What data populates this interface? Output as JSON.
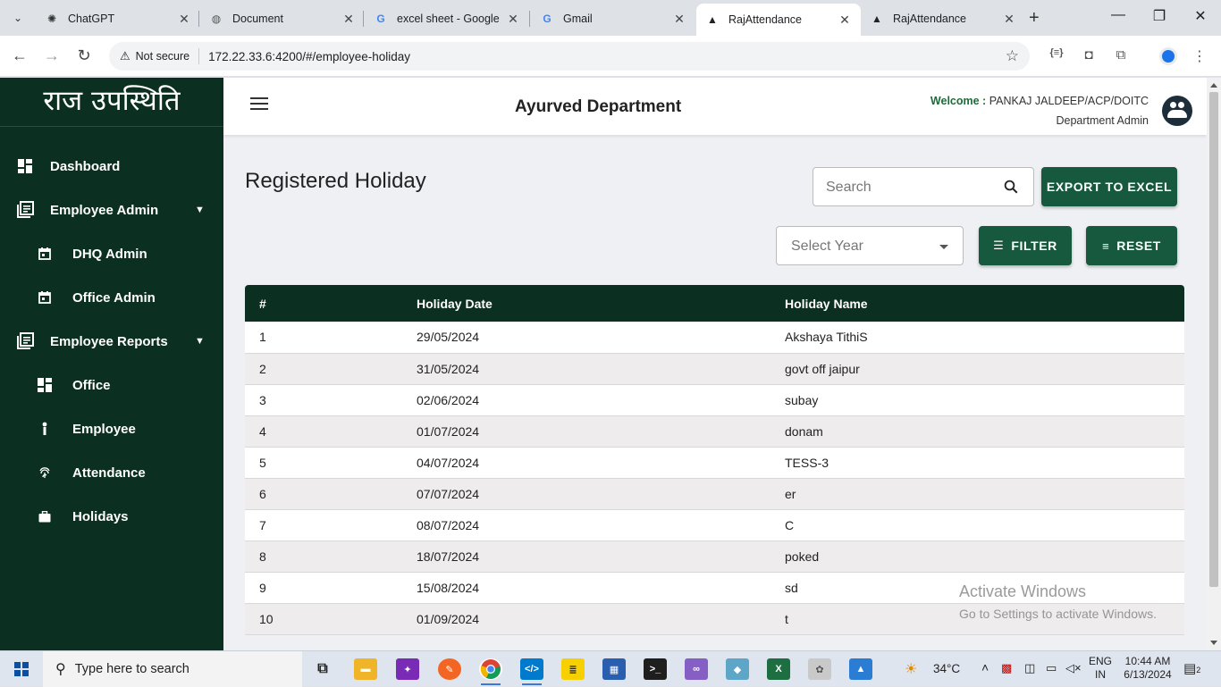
{
  "browser": {
    "tabs": [
      {
        "title": "ChatGPT",
        "favicon": "chatgpt-icon"
      },
      {
        "title": "Document",
        "favicon": "globe-icon"
      },
      {
        "title": "excel sheet - Google",
        "favicon": "google-icon"
      },
      {
        "title": "Gmail",
        "favicon": "google-icon"
      },
      {
        "title": "RajAttendance",
        "favicon": "angular-icon"
      },
      {
        "title": "RajAttendance",
        "favicon": "angular-icon"
      }
    ],
    "active_tab": 4,
    "security_label": "Not secure",
    "url": "172.22.33.6:4200/#/employee-holiday"
  },
  "sidebar": {
    "brand": "राज उपस्थिति",
    "items": [
      {
        "label": "Dashboard",
        "icon": "dashboard-icon",
        "sub": false,
        "chevron": false
      },
      {
        "label": "Employee Admin",
        "icon": "library-books-icon",
        "sub": false,
        "chevron": true
      },
      {
        "label": "DHQ Admin",
        "icon": "calendar-icon",
        "sub": true,
        "chevron": false
      },
      {
        "label": "Office Admin",
        "icon": "calendar-icon",
        "sub": true,
        "chevron": false
      },
      {
        "label": "Employee Reports",
        "icon": "library-books-icon",
        "sub": false,
        "chevron": true
      },
      {
        "label": "Office",
        "icon": "dashboard-icon",
        "sub": true,
        "chevron": false
      },
      {
        "label": "Employee",
        "icon": "person-icon",
        "sub": true,
        "chevron": false
      },
      {
        "label": "Attendance",
        "icon": "fingerprint-icon",
        "sub": true,
        "chevron": false
      },
      {
        "label": "Holidays",
        "icon": "briefcase-icon",
        "sub": true,
        "chevron": false
      }
    ]
  },
  "header": {
    "department": "Ayurved Department",
    "welcome_label": "Welcome :",
    "user": "PANKAJ JALDEEP/ACP/DOITC",
    "role": "Department Admin"
  },
  "main": {
    "title": "Registered Holiday",
    "search_placeholder": "Search",
    "export_label": "EXPORT TO EXCEL",
    "select_year_placeholder": "Select Year",
    "filter_label": "FILTER",
    "reset_label": "RESET",
    "columns": [
      "#",
      "Holiday Date",
      "Holiday Name"
    ],
    "rows": [
      [
        "1",
        "29/05/2024",
        "Akshaya TithiS"
      ],
      [
        "2",
        "31/05/2024",
        "govt off jaipur"
      ],
      [
        "3",
        "02/06/2024",
        "subay"
      ],
      [
        "4",
        "01/07/2024",
        "donam"
      ],
      [
        "5",
        "04/07/2024",
        "TESS-3"
      ],
      [
        "6",
        "07/07/2024",
        "er"
      ],
      [
        "7",
        "08/07/2024",
        "C"
      ],
      [
        "8",
        "18/07/2024",
        "poked"
      ],
      [
        "9",
        "15/08/2024",
        "sd"
      ],
      [
        "10",
        "01/09/2024",
        "t"
      ]
    ]
  },
  "watermark": {
    "line1": "Activate Windows",
    "line2": "Go to Settings to activate Windows."
  },
  "taskbar": {
    "search_placeholder": "Type here to search",
    "weather": "34°C",
    "lang1": "ENG",
    "lang2": "IN",
    "time": "10:44 AM",
    "date": "6/13/2024",
    "notifications": "2"
  },
  "colors": {
    "sidebar_bg": "#0b3022",
    "accent_green": "#17593e",
    "welcome_green": "#1e6b3a"
  }
}
